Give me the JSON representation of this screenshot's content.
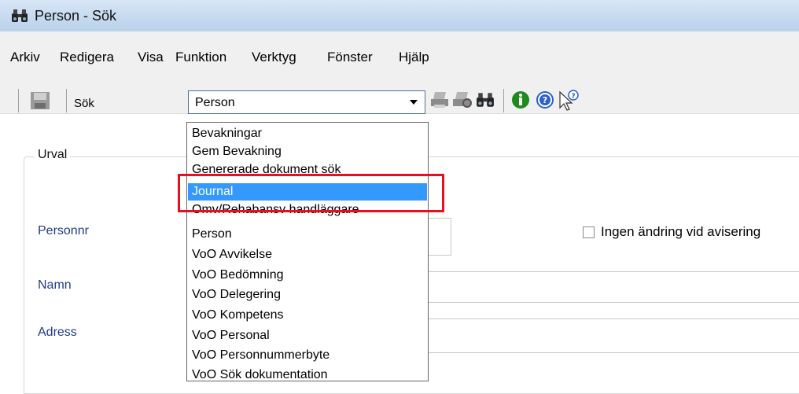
{
  "window": {
    "title": "Person - Sök",
    "title_icon": "binoculars-icon"
  },
  "menu": [
    "Arkiv",
    "Redigera",
    "Visa",
    "Funktion",
    "Verktyg",
    "Fönster",
    "Hjälp"
  ],
  "toolbar": {
    "search_label": "Sök",
    "combo_value": "Person",
    "icons": [
      "save-icon",
      "print-icon",
      "print-preview-icon",
      "binoculars-icon",
      "info-icon",
      "help-icon",
      "whats-this-icon"
    ]
  },
  "dropdown": {
    "options": [
      "Bevakningar",
      "Gem Bevakning",
      "Genererade dokument sök",
      "Journal",
      "Omv/Rehabansv handläggare",
      "Person",
      "VoO Avvikelse",
      "VoO Bedömning",
      "VoO Delegering",
      "VoO Kompetens",
      "VoO Personal",
      "VoO Personnummerbyte",
      "VoO Sök dokumentation"
    ],
    "selected": "Journal"
  },
  "form": {
    "group_title": "Urval",
    "labels": {
      "personnr": "Personnr",
      "namn": "Namn",
      "adress": "Adress"
    },
    "checkbox_label": "Ingen ändring vid avisering",
    "checkbox_checked": false
  },
  "annotation": {
    "color": "#e8101a"
  }
}
